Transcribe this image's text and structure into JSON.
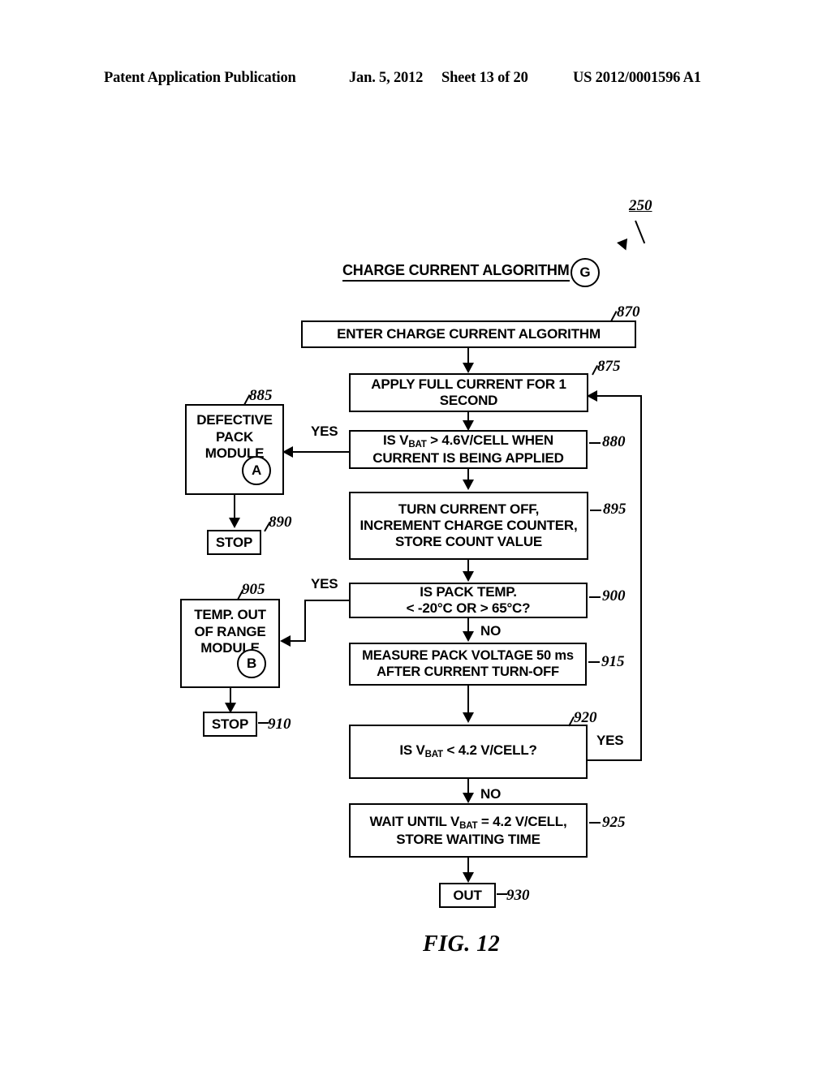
{
  "header": {
    "publication": "Patent Application Publication",
    "date": "Jan. 5, 2012",
    "sheet": "Sheet 13 of 20",
    "patent_number": "US 2012/0001596 A1"
  },
  "figure": {
    "caption": "FIG. 12",
    "diagram_ref": "250",
    "title": "CHARGE CURRENT ALGORITHM",
    "title_badge": "G"
  },
  "nodes": {
    "enter": {
      "ref": "870",
      "text": "ENTER CHARGE CURRENT ALGORITHM"
    },
    "apply_current": {
      "ref": "875",
      "line1": "APPLY FULL CURRENT FOR 1",
      "line2": "SECOND"
    },
    "vbat_check": {
      "ref": "880",
      "line1_pre": "IS V",
      "line1_sub": "BAT",
      "line1_post": " > 4.6V/CELL WHEN",
      "line2": "CURRENT IS BEING APPLIED"
    },
    "defective_pack": {
      "ref": "885",
      "line1": "DEFECTIVE",
      "line2": "PACK",
      "line3": "MODULE",
      "badge": "A"
    },
    "stop_defective": {
      "ref": "890",
      "text": "STOP"
    },
    "turn_off": {
      "ref": "895",
      "line1": "TURN CURRENT OFF,",
      "line2": "INCREMENT CHARGE COUNTER,",
      "line3": "STORE COUNT VALUE"
    },
    "temp_check": {
      "ref": "900",
      "line1": "IS PACK TEMP.",
      "line2": "< -20°C OR > 65°C?"
    },
    "temp_module": {
      "ref": "905",
      "line1": "TEMP. OUT",
      "line2": "OF RANGE",
      "line3": "MODULE",
      "badge": "B"
    },
    "stop_temp": {
      "ref": "910",
      "text": "STOP"
    },
    "measure": {
      "ref": "915",
      "line1": "MEASURE PACK VOLTAGE 50 ms",
      "line2": "AFTER CURRENT TURN-OFF"
    },
    "vbat_42": {
      "ref": "920",
      "pre": "IS V",
      "sub": "BAT",
      "post": " <  4.2 V/CELL?"
    },
    "wait": {
      "ref": "925",
      "line1_pre": "WAIT UNTIL V",
      "line1_sub": "BAT",
      "line1_post": " = 4.2 V/CELL,",
      "line2": "STORE WAITING TIME"
    },
    "out": {
      "ref": "930",
      "text": "OUT"
    }
  },
  "branch_labels": {
    "yes_defective": "YES",
    "no_temp": "NO",
    "yes_temp": "YES",
    "yes_vbat42": "YES",
    "no_vbat42": "NO"
  }
}
